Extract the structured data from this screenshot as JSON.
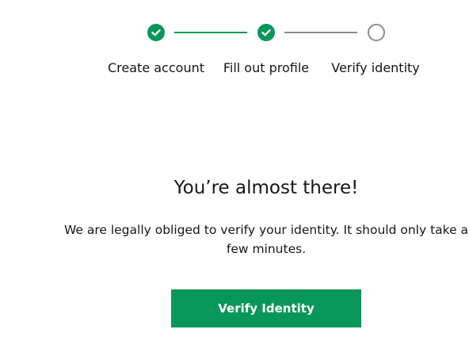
{
  "stepper": {
    "steps": [
      {
        "label": "Create account",
        "status": "complete"
      },
      {
        "label": "Fill out profile",
        "status": "complete"
      },
      {
        "label": "Verify identity",
        "status": "incomplete"
      }
    ]
  },
  "main": {
    "heading": "You’re almost there!",
    "description_line1": "We are legally obliged to verify your identity. It should only take a",
    "description_line2": "few minutes.",
    "cta_label": "Verify Identity"
  },
  "colors": {
    "accent": "#08965a",
    "pending": "#8d8d8d",
    "text": "#161616"
  },
  "icons": {
    "complete": "checkmark-icon",
    "incomplete": "empty-circle-icon"
  }
}
